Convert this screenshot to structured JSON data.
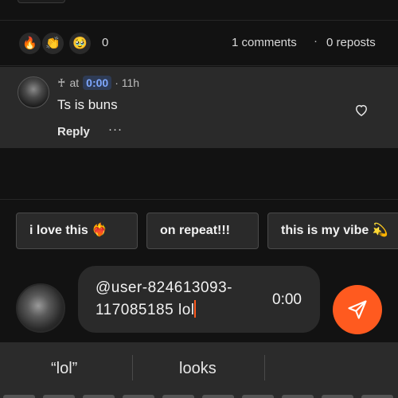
{
  "reactions": {
    "emojis": [
      "🔥",
      "👏",
      "🥹"
    ],
    "count": "0",
    "comments_label": "1 comments",
    "separator": "·",
    "reposts_label": "0 reposts"
  },
  "comment": {
    "author_symbol": "♰",
    "at_label": "at",
    "timestamp": "0:00",
    "age": "· 11h",
    "text": "Ts is buns",
    "reply_label": "Reply",
    "more_label": "···"
  },
  "quick_replies": [
    "i love this ❤️‍🔥",
    "on repeat!!!",
    "this is my vibe 💫"
  ],
  "composer": {
    "text": "@user-824613093-117085185 lol",
    "time": "0:00"
  },
  "keyboard": {
    "suggestions": [
      "“lol”",
      "looks"
    ]
  },
  "colors": {
    "accent": "#ff5a1f",
    "timestamp_blue": "#7fa8ff",
    "background": "#121212",
    "surface": "#2a2a2a"
  }
}
